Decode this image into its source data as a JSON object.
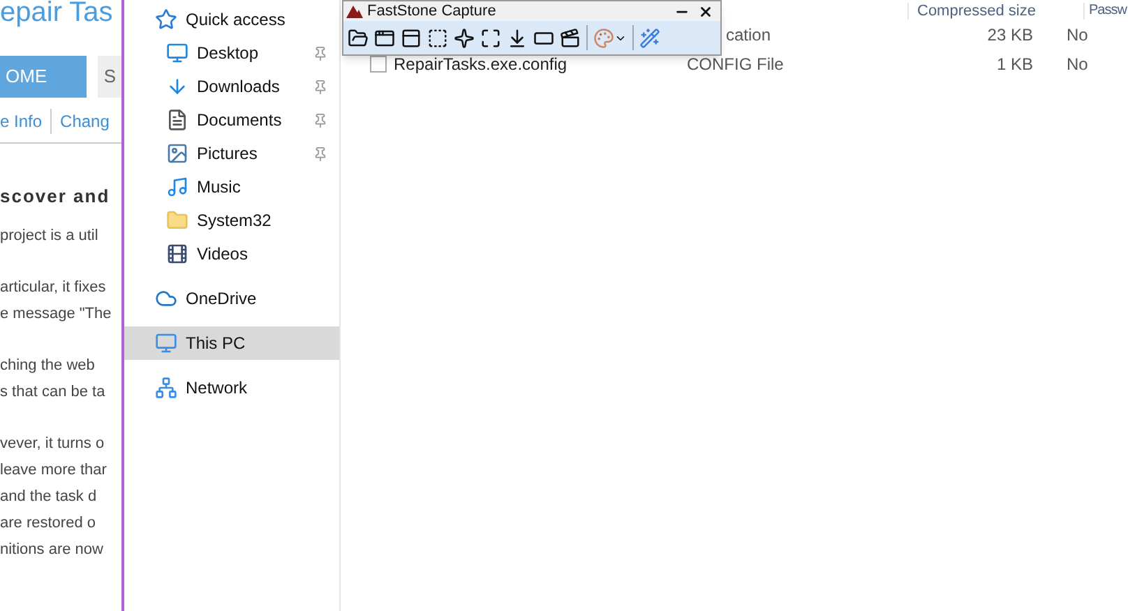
{
  "web_page": {
    "title": "epair Tas",
    "tabs": [
      {
        "label": "OME",
        "selected": true
      },
      {
        "label": "S",
        "selected": false
      }
    ],
    "links": [
      "e Info",
      "Chang"
    ],
    "heading": "scover and",
    "paragraphs": [
      [
        "project is a util"
      ],
      [
        "articular, it fixes",
        "e message \"The"
      ],
      [
        "ching the web",
        "s that can be ta"
      ],
      [
        "vever, it turns o",
        "leave more thar",
        "and the task d",
        "are restored o",
        "nitions are now"
      ]
    ]
  },
  "navigation_pane": {
    "items": [
      {
        "label": "Quick access",
        "pinned": false,
        "selected": false,
        "children": [
          {
            "label": "Desktop",
            "pinned": true,
            "selected": false
          },
          {
            "label": "Downloads",
            "pinned": true,
            "selected": false
          },
          {
            "label": "Documents",
            "pinned": true,
            "selected": false
          },
          {
            "label": "Pictures",
            "pinned": true,
            "selected": false
          },
          {
            "label": "Music",
            "pinned": false,
            "selected": false
          },
          {
            "label": "System32",
            "pinned": false,
            "selected": false
          },
          {
            "label": "Videos",
            "pinned": false,
            "selected": false
          }
        ]
      },
      {
        "label": "OneDrive",
        "pinned": false,
        "selected": false
      },
      {
        "label": "This PC",
        "pinned": false,
        "selected": true
      },
      {
        "label": "Network",
        "pinned": false,
        "selected": false
      }
    ]
  },
  "file_list": {
    "columns": [
      "Compressed size",
      "Passw"
    ],
    "rows": [
      {
        "type": "cation",
        "size": "23 KB",
        "password": "No"
      },
      {
        "name": "RepairTasks.exe.config",
        "type": "CONFIG File",
        "size": "1 KB",
        "password": "No",
        "checked": false
      }
    ]
  },
  "capture_toolbar": {
    "title": "FastStone Capture"
  }
}
